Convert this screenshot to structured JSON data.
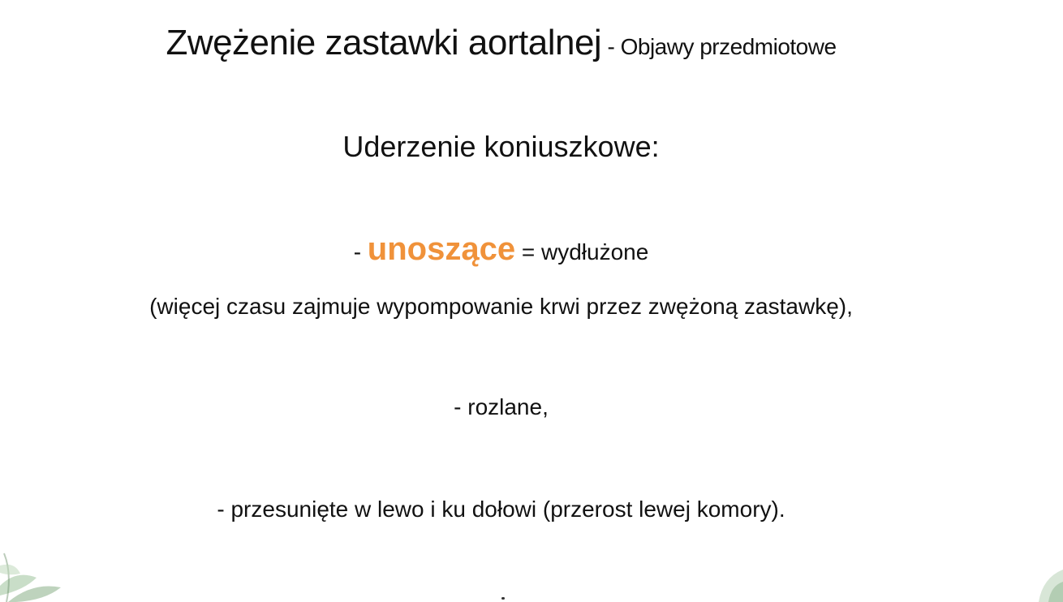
{
  "slide": {
    "title_main": "Zwężenie zastawki aortalnej",
    "title_sub": " - Objawy przedmiotowe",
    "heading": "Uderzenie koniuszkowe:",
    "bullet1_prefix": "- ",
    "bullet1_accent": "unoszące",
    "bullet1_suffix": " = wydłużone",
    "bullet1_note": "(więcej czasu zajmuje wypompowanie krwi przez zwężoną zastawkę),",
    "bullet2": "- rozlane,",
    "bullet3": "- przesunięte w lewo i ku dołowi (przerost lewej komory)."
  },
  "colors": {
    "accent": "#f0923a",
    "text": "#111111",
    "background": "#ffffff"
  },
  "decorations": {
    "left_icon": "leaf-decoration-icon",
    "right_icon": "leaf-decoration-icon"
  }
}
